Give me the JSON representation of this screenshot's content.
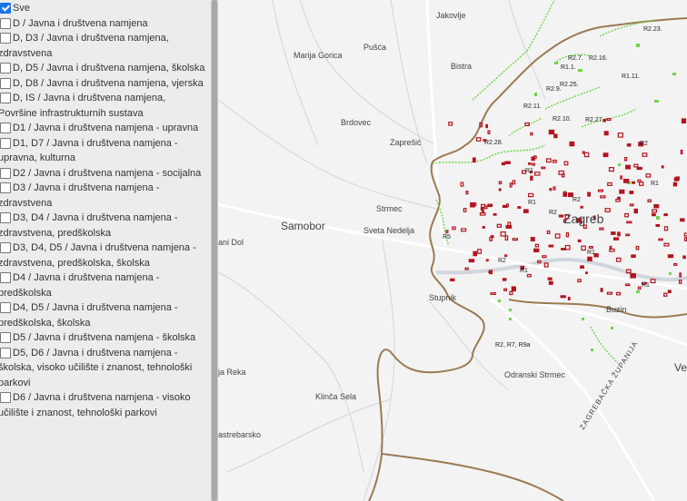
{
  "legend": {
    "items": [
      {
        "label": "Sve",
        "checked": true
      },
      {
        "label": "D / Javna i društvena namjena",
        "checked": false
      },
      {
        "label": "D, D3 / Javna i društvena namjena, zdravstvena",
        "checked": false
      },
      {
        "label": "D, D5 / Javna i društvena namjena, školska",
        "checked": false
      },
      {
        "label": "D, D8 / Javna i društvena namjena, vjerska",
        "checked": false
      },
      {
        "label": "D, IS / Javna i društvena namjena, Površine infrastrukturnih sustava",
        "checked": false
      },
      {
        "label": "D1 / Javna i društvena namjena - upravna",
        "checked": false
      },
      {
        "label": "D1, D7 / Javna i društvena namjena - upravna, kulturna",
        "checked": false
      },
      {
        "label": "D2 / Javna i društvena namjena - socijalna",
        "checked": false
      },
      {
        "label": "D3 / Javna i društvena namjena - zdravstvena",
        "checked": false
      },
      {
        "label": "D3, D4 / Javna i društvena namjena - zdravstvena, predškolska",
        "checked": false
      },
      {
        "label": "D3, D4, D5 / Javna i društvena namjena - zdravstvena, predškolska, školska",
        "checked": false
      },
      {
        "label": "D4 / Javna i društvena namjena - predškolska",
        "checked": false
      },
      {
        "label": "D4, D5 / Javna i društvena namjena - predškolska, školska",
        "checked": false
      },
      {
        "label": "D5 / Javna i društvena namjena - školska",
        "checked": false
      },
      {
        "label": "D5, D6 / Javna i društvena namjena - školska, visoko učilište i znanost, tehnološki parkovi",
        "checked": false
      },
      {
        "label": "D6 / Javna i društvena namjena - visoko učilište i znanost, tehnološki parkovi",
        "checked": false
      }
    ]
  },
  "map": {
    "places": {
      "jakovlje": "Jakovlje",
      "pusca": "Pušća",
      "marija_gorica": "Marija Gorica",
      "bistra": "Bistra",
      "brdovec": "Brdovec",
      "zapresic": "Zaprešić",
      "strmec": "Strmec",
      "samobor": "Samobor",
      "sveta_nedelja": "Sveta Nedelja",
      "ani_dol": "ani Dol",
      "zagreb": "Zagreb",
      "stupnik": "Stupnik",
      "buzin": "Buzin",
      "ja_reka": "ja Reka",
      "odranski_strmec": "Odranski Strmec",
      "klinca_sela": "Klinča Sela",
      "astrebarsko": "astrebarsko",
      "ve": "Ve",
      "county": "ZAGREBAČKA ŽUPANIJA"
    },
    "zones": {
      "r2_7": "R2.7.",
      "r2_16": "R2.16.",
      "r1_1": "R1.1.",
      "r2_23": "R2.23.",
      "r1_11": "R1.11.",
      "r2_9": "R2.9.",
      "r2_25": "R2.25.",
      "r2_11": "R2.11.",
      "r2_10": "R2.10.",
      "r2_27": "R2.27.",
      "r2_28": "R2.28.",
      "r1a": "R1",
      "r1b": "R1",
      "r1c": "R1",
      "r1d": "R1",
      "r1e": "R1",
      "r1f": "R1",
      "r2a": "R2",
      "r2b": "R2",
      "r2c": "R2",
      "r5": "R5",
      "r2_r7_r9a": "R2, R7, R9a",
      "r2d": "R2"
    }
  },
  "colors": {
    "boundary": "#9a7a52",
    "green_zone": "#6fd44a",
    "red_zone": "#b3141f",
    "road": "#ffffff",
    "minor_road": "#cfcfcf"
  }
}
